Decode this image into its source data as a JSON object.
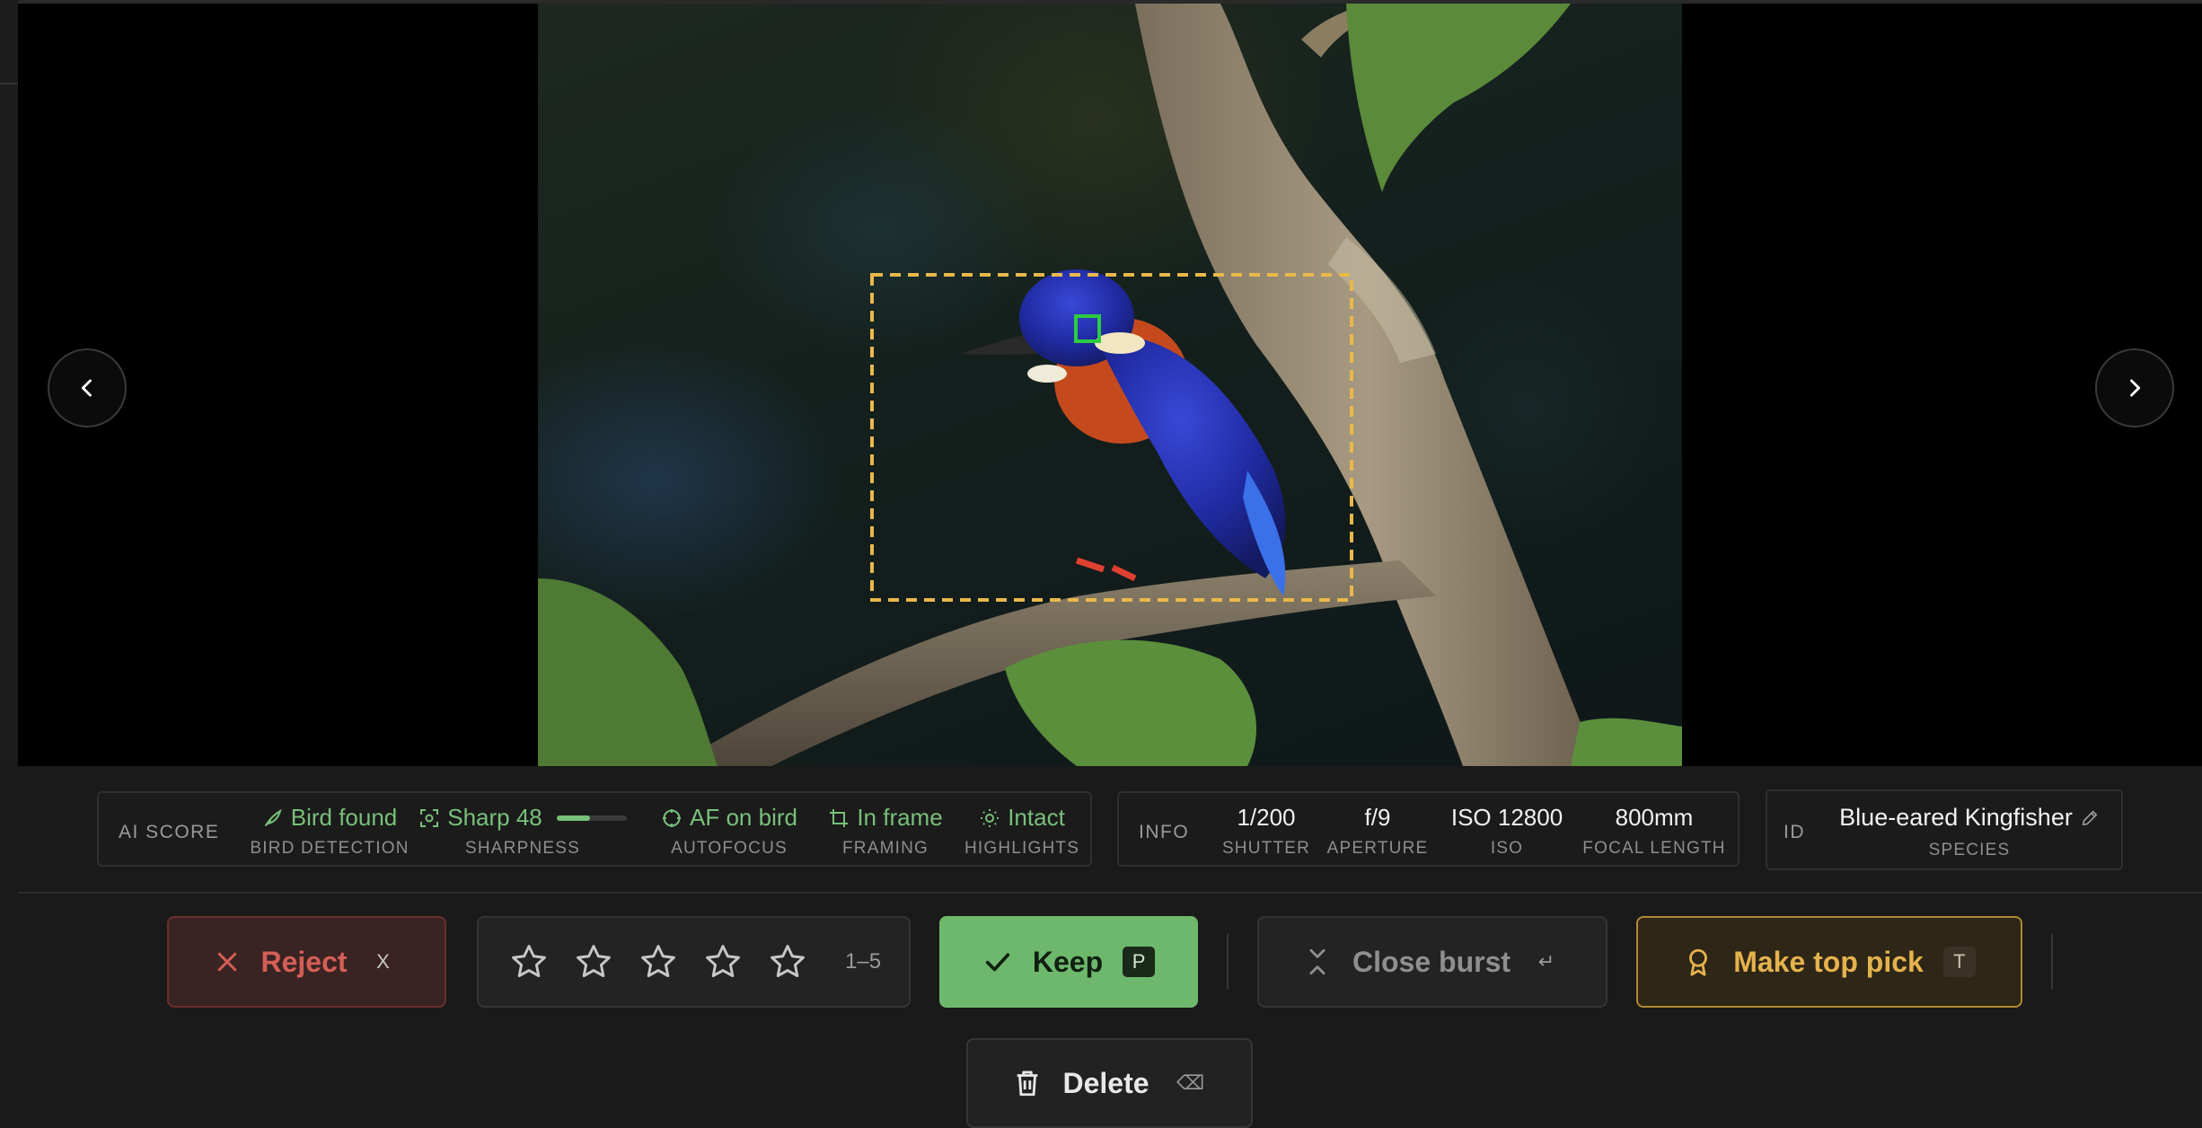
{
  "viewer": {
    "prev_icon": "chevron-left-icon",
    "next_icon": "chevron-right-icon",
    "detection_box_color": "#e8b84a",
    "focus_point_color": "#2ecc40"
  },
  "ai_score": {
    "title": "AI SCORE",
    "bird_detection": {
      "value": "Bird found",
      "label": "BIRD DETECTION",
      "icon": "bird-icon"
    },
    "sharpness": {
      "value": "Sharp 48",
      "label": "SHARPNESS",
      "icon": "focus-frame-icon",
      "level": 0.48
    },
    "autofocus": {
      "value": "AF on bird",
      "label": "AUTOFOCUS",
      "icon": "crosshair-icon"
    },
    "framing": {
      "value": "In frame",
      "label": "FRAMING",
      "icon": "crop-icon"
    },
    "highlights": {
      "value": "Intact",
      "label": "HIGHLIGHTS",
      "icon": "sun-icon"
    },
    "status_color": "#78c07a"
  },
  "info": {
    "title": "INFO",
    "shutter": {
      "value": "1/200",
      "label": "SHUTTER"
    },
    "aperture": {
      "value": "f/9",
      "label": "APERTURE"
    },
    "iso": {
      "value": "ISO 12800",
      "label": "ISO"
    },
    "focal_length": {
      "value": "800mm",
      "label": "FOCAL LENGTH"
    }
  },
  "id_panel": {
    "title": "ID",
    "species": "Blue-eared Kingfisher",
    "label": "SPECIES",
    "edit_icon": "pencil-icon"
  },
  "actions": {
    "reject": {
      "label": "Reject",
      "key": "X",
      "icon": "x-icon"
    },
    "rating": {
      "range": "1–5",
      "stars": 5,
      "value": 0
    },
    "keep": {
      "label": "Keep",
      "key": "P",
      "icon": "check-icon"
    },
    "close_burst": {
      "label": "Close burst",
      "key": "↵",
      "icon": "collapse-icon"
    },
    "top_pick": {
      "label": "Make top pick",
      "key": "T",
      "icon": "award-icon"
    },
    "delete": {
      "label": "Delete",
      "key": "⌫",
      "icon": "trash-icon"
    }
  }
}
